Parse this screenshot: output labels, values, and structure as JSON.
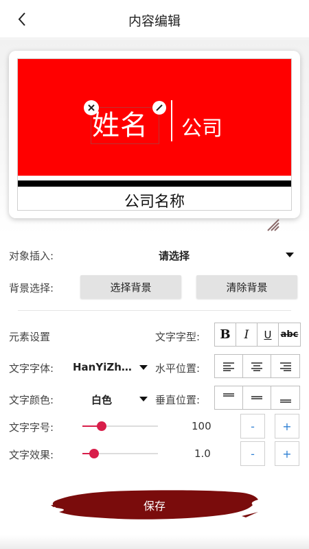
{
  "header": {
    "title": "内容编辑",
    "back_icon": "chevron-left-icon"
  },
  "preview": {
    "name_text": "姓名",
    "company_short": "公司",
    "company_name": "公司名称",
    "background_color": "#ff0000",
    "bar_color": "#000000"
  },
  "insert": {
    "label": "对象插入:",
    "value": "请选择"
  },
  "background": {
    "label": "背景选择:",
    "choose_button": "选择背景",
    "clear_button": "清除背景"
  },
  "element": {
    "settings_label": "元素设置",
    "style_label": "文字字型:",
    "style_buttons": [
      "B",
      "I",
      "U",
      "abc"
    ],
    "font_label": "文字字体:",
    "font_value": "HanYiZh…",
    "halign_label": "水平位置:",
    "color_label": "文字颜色:",
    "color_value": "白色",
    "valign_label": "垂直位置:",
    "size_label": "文字字号:",
    "size_value": "100",
    "size_fraction": 0.25,
    "effect_label": "文字效果:",
    "effect_value": "1.0",
    "effect_fraction": 0.15,
    "minus": "-",
    "plus": "+"
  },
  "save": {
    "label": "保存",
    "color": "#7a0c0c"
  },
  "accent_color": "#d81e4a"
}
